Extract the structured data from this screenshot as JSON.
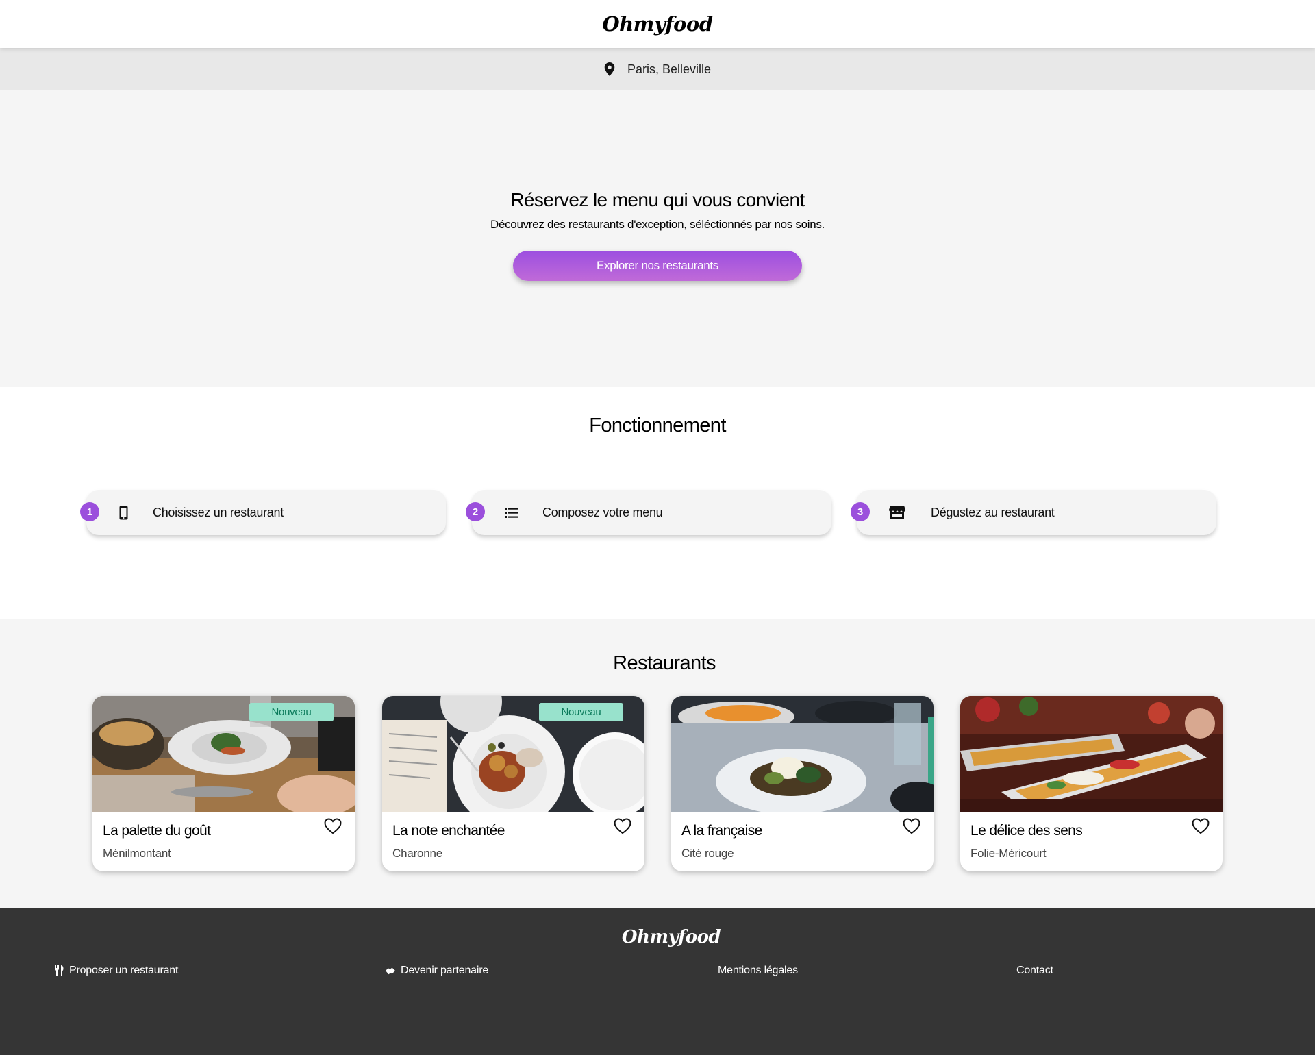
{
  "header": {
    "logo": "Ohmyfood"
  },
  "location": {
    "text": "Paris, Belleville",
    "icon": "map-marker-icon"
  },
  "hero": {
    "title": "Réservez le menu qui vous convient",
    "subtitle": "Découvrez des restaurants d'exception, séléctionnés par nos soins.",
    "cta_label": "Explorer nos restaurants"
  },
  "how": {
    "title": "Fonctionnement",
    "steps": [
      {
        "num": "1",
        "label": "Choisissez un restaurant",
        "icon": "mobile-phone-icon"
      },
      {
        "num": "2",
        "label": "Composez votre menu",
        "icon": "list-icon"
      },
      {
        "num": "3",
        "label": "Dégustez au restaurant",
        "icon": "store-icon"
      }
    ]
  },
  "restaurants": {
    "title": "Restaurants",
    "cards": [
      {
        "name": "La palette du goût",
        "area": "Ménilmontant",
        "badge": "Nouveau"
      },
      {
        "name": "La note enchantée",
        "area": "Charonne",
        "badge": "Nouveau"
      },
      {
        "name": "A la française",
        "area": "Cité rouge",
        "badge": ""
      },
      {
        "name": "Le délice des sens",
        "area": "Folie-Méricourt",
        "badge": ""
      }
    ]
  },
  "footer": {
    "logo": "Ohmyfood",
    "links": [
      {
        "label": "Proposer un restaurant",
        "icon": "utensils-icon"
      },
      {
        "label": "Devenir partenaire",
        "icon": "handshake-icon"
      },
      {
        "label": "Mentions légales"
      },
      {
        "label": "Contact"
      }
    ]
  },
  "colors": {
    "accent": "#9b4fdc",
    "badge_bg": "#98e2cc",
    "footer_bg": "#353535"
  }
}
